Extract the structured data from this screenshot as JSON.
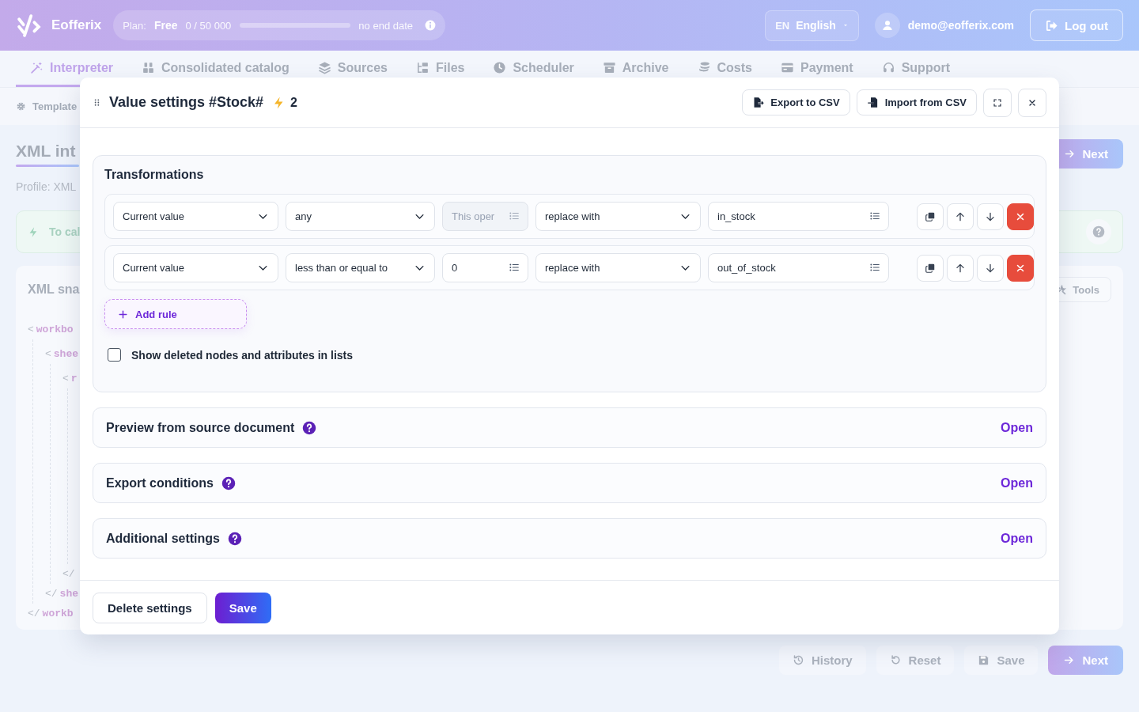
{
  "header": {
    "logo": "Eofferix",
    "plan": {
      "label": "Plan:",
      "name": "Free",
      "usage": "0 / 50 000",
      "level": 0,
      "end": "no end date"
    },
    "language": {
      "code": "EN",
      "name": "English"
    },
    "user": {
      "email": "demo@eofferix.com"
    },
    "logout": "Log out"
  },
  "nav": {
    "tabs": [
      {
        "label": "Interpreter",
        "selected": true
      },
      {
        "label": "Consolidated catalog",
        "selected": false
      },
      {
        "label": "Sources",
        "selected": false
      },
      {
        "label": "Files",
        "selected": false
      },
      {
        "label": "Scheduler",
        "selected": false
      },
      {
        "label": "Archive",
        "selected": false
      },
      {
        "label": "Costs",
        "selected": false
      },
      {
        "label": "Payment",
        "selected": false
      },
      {
        "label": "Support",
        "selected": false
      }
    ]
  },
  "subbar": {
    "template": "Template"
  },
  "page": {
    "title": "XML int",
    "next": "Next",
    "profile": "Profile: XML",
    "notice": "To cal",
    "snapshot": {
      "title": "XML sna",
      "tools": "Tools",
      "nodes": [
        {
          "open": {
            "bracket": "<",
            "tag": "workbo"
          },
          "close": {
            "bracket": "</",
            "tag": "workb"
          },
          "children": [
            {
              "open": {
                "bracket": "<",
                "tag": "shee"
              },
              "close": {
                "bracket": "</",
                "tag": "she"
              },
              "children": [
                {
                  "open": {
                    "bracket": "<",
                    "tag": "r"
                  },
                  "close": {
                    "bracket": "</"
                  }
                }
              ]
            }
          ]
        }
      ]
    }
  },
  "bottom_buttons": [
    {
      "label": "History",
      "kind": "history"
    },
    {
      "label": "Reset",
      "kind": "reset"
    },
    {
      "label": "Save",
      "kind": "save"
    },
    {
      "label": "Next",
      "kind": "next"
    }
  ],
  "modal": {
    "title": "Value settings #Stock#",
    "badge": "2",
    "actions": [
      {
        "label": "Export to CSV",
        "kind": "export"
      },
      {
        "label": "Import from CSV",
        "kind": "import"
      }
    ],
    "transformations": {
      "title": "Transformations",
      "rules": [
        {
          "source": "Current value",
          "operator": "any",
          "operand": {
            "placeholder": "This oper",
            "disabled": true
          },
          "action": "replace with",
          "result": "in_stock"
        },
        {
          "source": "Current value",
          "operator": "less than or equal to",
          "operand": {
            "value": "0",
            "disabled": false
          },
          "action": "replace with",
          "result": "out_of_stock"
        }
      ],
      "add_rule": "Add rule",
      "show_deleted": {
        "label": "Show deleted nodes and attributes in lists",
        "checked": false
      }
    },
    "sections": [
      {
        "title": "Preview from source document",
        "toggle": "Open"
      },
      {
        "title": "Export conditions",
        "toggle": "Open"
      },
      {
        "title": "Additional settings",
        "toggle": "Open"
      }
    ],
    "footer": {
      "delete": "Delete settings",
      "save": "Save"
    }
  }
}
